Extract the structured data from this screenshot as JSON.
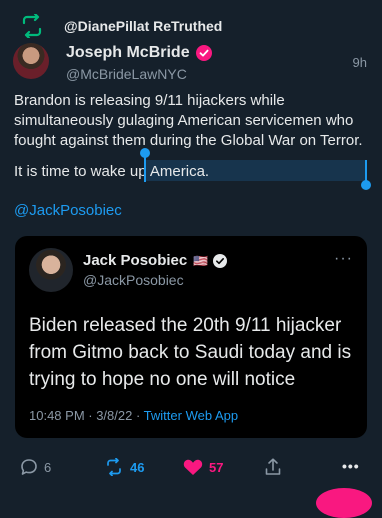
{
  "retruth": {
    "label": "@DianePillat ReTruthed"
  },
  "post": {
    "author": "Joseph McBride",
    "handle": "@McBrideLawNYC",
    "time": "9h",
    "paragraph1": "Brandon is releasing 9/11 hijackers while simultaneously gulaging American servicemen who fought against them during the Global War on Terror.",
    "line_prefix": "It is time to wake up ",
    "selected_word": "America.",
    "mention": "@JackPosobiec"
  },
  "quoted": {
    "author": "Jack Posobiec",
    "flag": "🇺🇸",
    "handle": "@JackPosobiec",
    "more": "···",
    "text": "Biden released the 20th 9/11 hijacker from Gitmo back to Saudi today and is trying to hope no one will notice",
    "timestamp": "10:48 PM · 3/8/22 · ",
    "app": "Twitter Web App"
  },
  "actions": {
    "replies": "6",
    "retruths": "46",
    "likes": "57",
    "more": "•••"
  },
  "colors": {
    "background": "#15202b",
    "accent": "#1d9bf0",
    "green": "#00ba7c",
    "pink": "#f91880",
    "muted": "#8b98a5"
  }
}
